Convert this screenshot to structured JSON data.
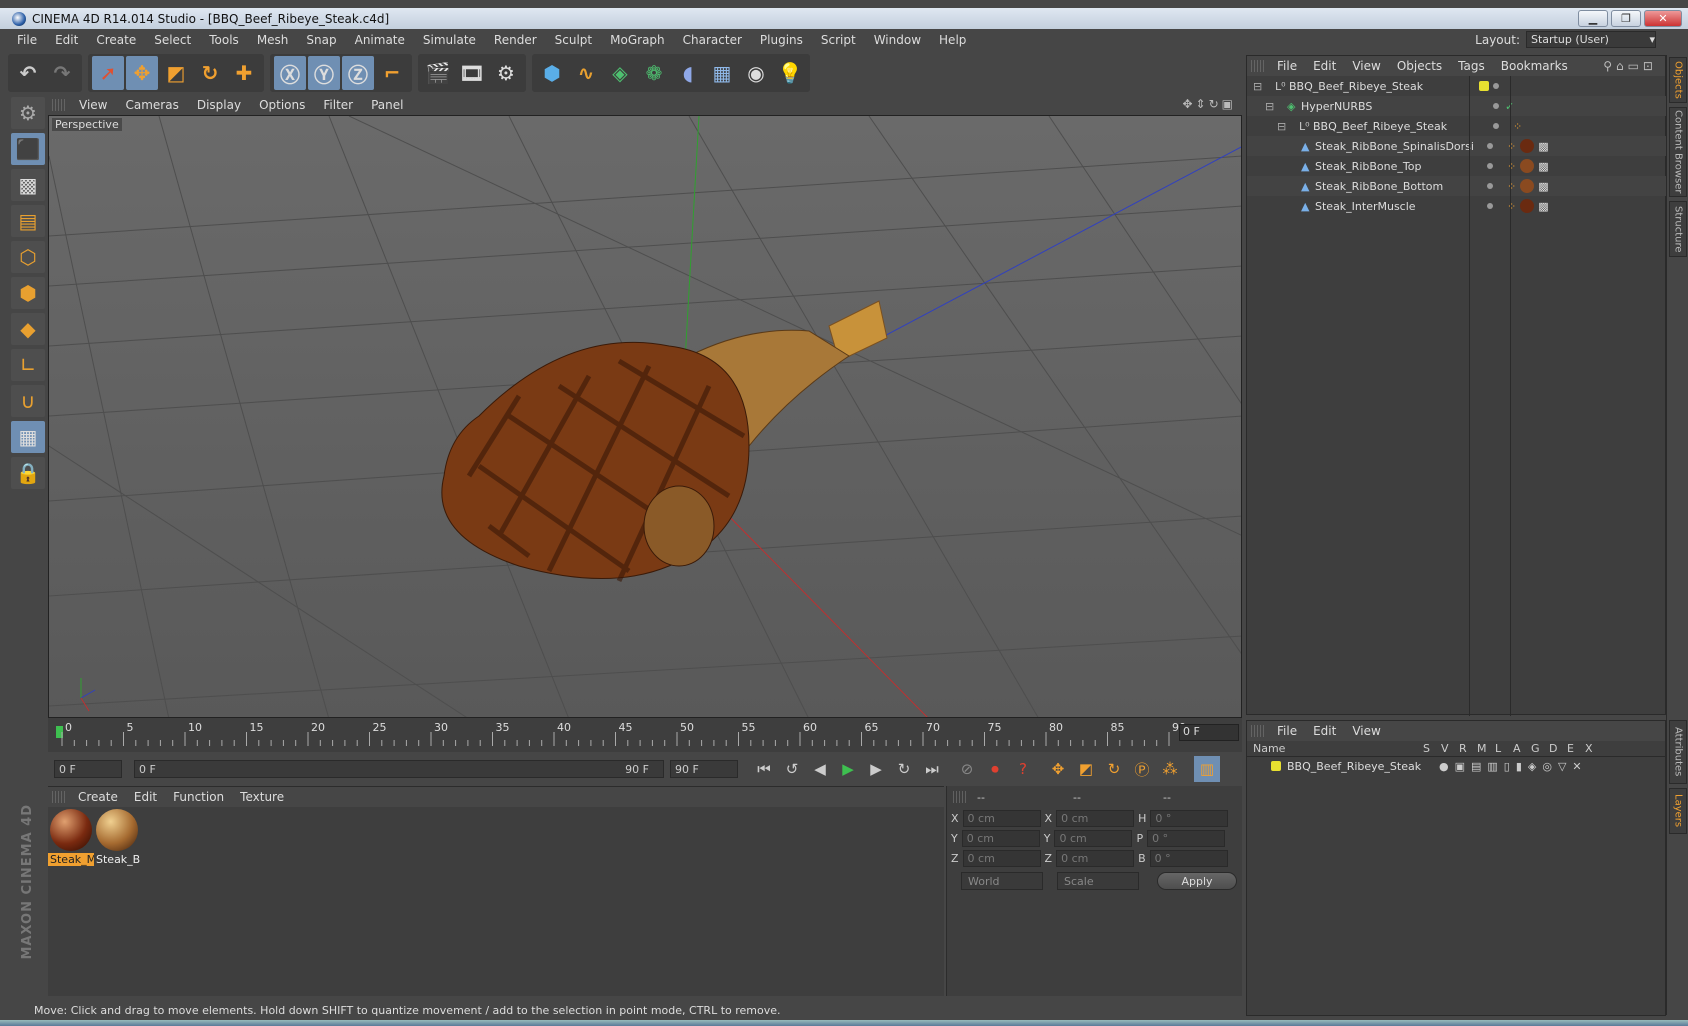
{
  "window": {
    "title": "CINEMA 4D R14.014 Studio - [BBQ_Beef_Ribeye_Steak.c4d]",
    "min": "▁",
    "max": "❐",
    "close": "✕"
  },
  "menu": [
    "File",
    "Edit",
    "Create",
    "Select",
    "Tools",
    "Mesh",
    "Snap",
    "Animate",
    "Simulate",
    "Render",
    "Sculpt",
    "MoGraph",
    "Character",
    "Plugins",
    "Script",
    "Window",
    "Help"
  ],
  "layout": {
    "label": "Layout:",
    "value": "Startup (User)"
  },
  "viewport": {
    "menu": [
      "View",
      "Cameras",
      "Display",
      "Options",
      "Filter",
      "Panel"
    ],
    "label": "Perspective"
  },
  "timeline": {
    "ticks": [
      "0",
      "5",
      "10",
      "15",
      "20",
      "25",
      "30",
      "35",
      "40",
      "45",
      "50",
      "55",
      "60",
      "65",
      "70",
      "75",
      "80",
      "85",
      "90"
    ],
    "current": "0 F"
  },
  "playbar": {
    "start": "0 F",
    "range_start": "0 F",
    "range_end": "90 F",
    "end": "90 F"
  },
  "materials": {
    "menu": [
      "Create",
      "Edit",
      "Function",
      "Texture"
    ],
    "items": [
      {
        "label": "Steak_M",
        "selected": true,
        "color": "#7a2a10"
      },
      {
        "label": "Steak_B",
        "selected": false,
        "color": "#a56a30"
      }
    ]
  },
  "coords": {
    "headers": [
      "--",
      "--",
      "--"
    ],
    "rows": [
      {
        "a": "X",
        "av": "0 cm",
        "b": "X",
        "bv": "0 cm",
        "c": "H",
        "cv": "0 °"
      },
      {
        "a": "Y",
        "av": "0 cm",
        "b": "Y",
        "bv": "0 cm",
        "c": "P",
        "cv": "0 °"
      },
      {
        "a": "Z",
        "av": "0 cm",
        "b": "Z",
        "bv": "0 cm",
        "c": "B",
        "cv": "0 °"
      }
    ],
    "world": "World",
    "scale": "Scale",
    "apply": "Apply"
  },
  "objects": {
    "menu": [
      "File",
      "Edit",
      "View",
      "Objects",
      "Tags",
      "Bookmarks"
    ],
    "items": [
      {
        "name": "BBQ_Beef_Ribeye_Steak",
        "level": 0
      },
      {
        "name": "HyperNURBS",
        "level": 1
      },
      {
        "name": "BBQ_Beef_Ribeye_Steak",
        "level": 2
      },
      {
        "name": "Steak_RibBone_SpinalisDorsi",
        "level": 3
      },
      {
        "name": "Steak_RibBone_Top",
        "level": 3
      },
      {
        "name": "Steak_RibBone_Bottom",
        "level": 3
      },
      {
        "name": "Steak_InterMuscle",
        "level": 3
      }
    ]
  },
  "layers": {
    "menu": [
      "File",
      "Edit",
      "View"
    ],
    "cols": [
      "Name",
      "S",
      "V",
      "R",
      "M",
      "L",
      "A",
      "G",
      "D",
      "E",
      "X"
    ],
    "row": "BBQ_Beef_Ribeye_Steak"
  },
  "sidetabs": [
    "Objects",
    "Content Browser",
    "Structure",
    "Attributes",
    "Layers"
  ],
  "brand": "MAXON CINEMA 4D",
  "status": "Move: Click and drag to move elements. Hold down SHIFT to quantize movement / add to the selection in point mode, CTRL to remove.",
  "colors": {
    "accent": "#f0a030",
    "select": "#6f8fb3",
    "axis_x": "#c03030",
    "axis_y": "#30a030",
    "axis_z": "#3040c0"
  }
}
